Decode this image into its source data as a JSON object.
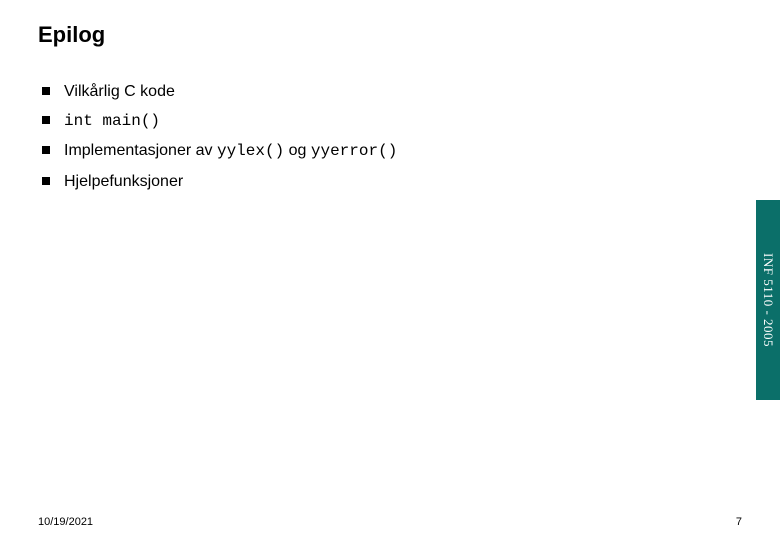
{
  "title": "Epilog",
  "bullets": {
    "b0": {
      "text": "Vilkårlig C kode"
    },
    "b1": {
      "code": "int main()"
    },
    "b2": {
      "pre": "Implementasjoner av ",
      "code1": "yylex()",
      "mid": " og ",
      "code2": "yyerror()"
    },
    "b3": {
      "text": "Hjelpefunksjoner"
    }
  },
  "sidebar_label": "INF 5110 - 2005",
  "footer": {
    "date": "10/19/2021",
    "page": "7"
  }
}
